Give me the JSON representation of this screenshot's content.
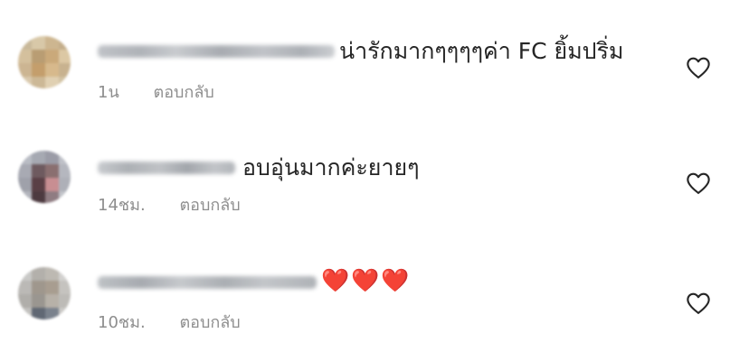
{
  "comments": [
    {
      "username": "",
      "text": "น่ารักมากๆๆๆๆค่า  FC ยิ้มปริ่ม",
      "time": "1น",
      "reply_label": "ตอบกลับ",
      "like_icon": "heart-outline-icon"
    },
    {
      "username": "",
      "text": "อบอุ่นมากค่ะยายๆ",
      "time": "14ชม.",
      "reply_label": "ตอบกลับ",
      "like_icon": "heart-outline-icon"
    },
    {
      "username": "",
      "text": "❤️❤️❤️",
      "time": "10ชม.",
      "reply_label": "ตอบกลับ",
      "like_icon": "heart-outline-icon"
    }
  ],
  "colors": {
    "text": "#262626",
    "meta": "#8e8e8e",
    "heart_stroke": "#262626",
    "emoji_heart": "#e0212f"
  }
}
